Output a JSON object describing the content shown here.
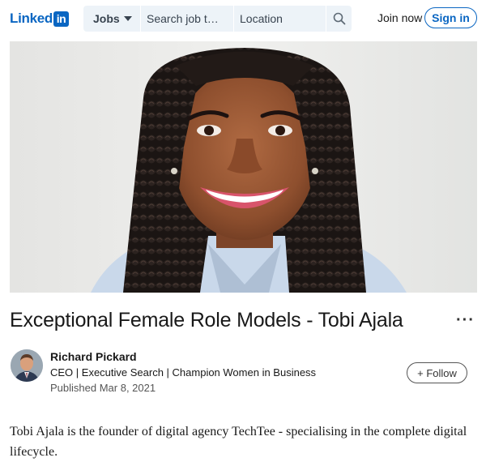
{
  "brand": {
    "word": "Linked",
    "box": "in",
    "color": "#0a66c2"
  },
  "nav": {
    "jobs_label": "Jobs",
    "keyword_placeholder": "Search job t…",
    "location_placeholder": "Location",
    "search_icon": "search-icon",
    "join_label": "Join now",
    "signin_label": "Sign in"
  },
  "hero": {
    "description_icon": "profile-photo"
  },
  "article": {
    "title": "Exceptional Female Role Models - Tobi Ajala",
    "more_label": "···",
    "author": {
      "name": "Richard Pickard",
      "headline": "CEO | Executive Search | Champion Women in Business",
      "published": "Published Mar 8, 2021"
    },
    "follow_label": "+ Follow",
    "body": "Tobi Ajala is the founder of digital agency TechTee - specialising in the complete digital lifecycle."
  }
}
